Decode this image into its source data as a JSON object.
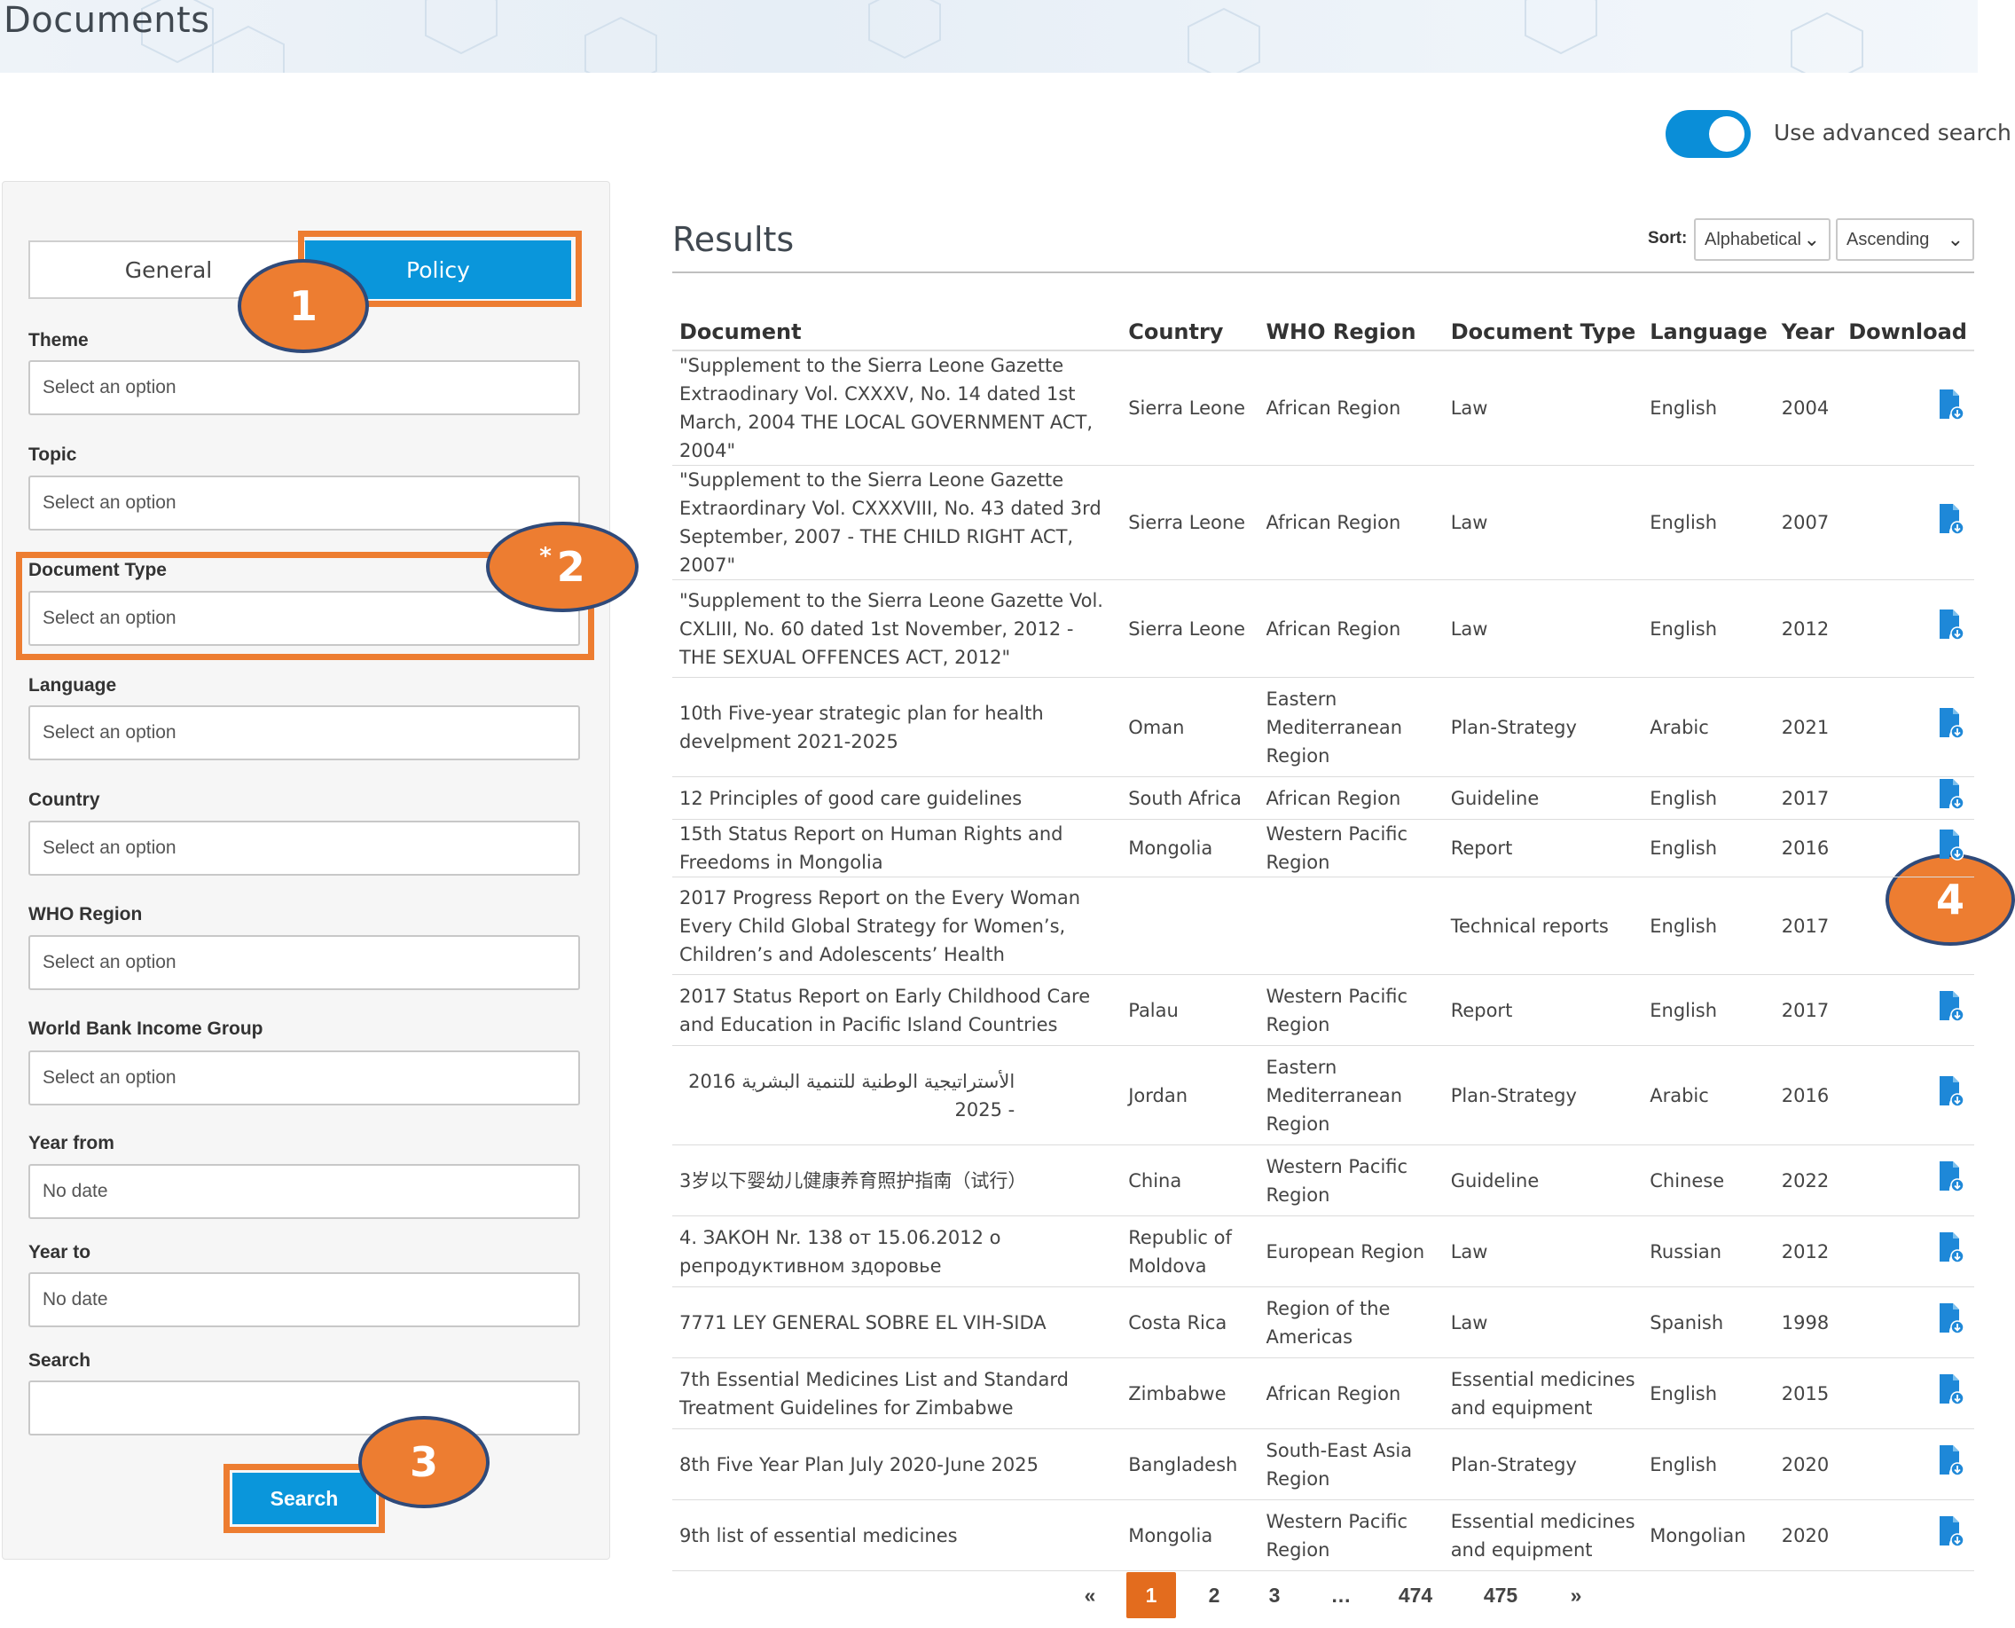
{
  "page": {
    "title": "Documents",
    "advanced_search_label": "Use advanced search",
    "advanced_search_on": true
  },
  "filters": {
    "tabs": {
      "general": "General",
      "policy": "Policy",
      "active": "Policy"
    },
    "theme": {
      "label": "Theme",
      "placeholder": "Select an option"
    },
    "topic": {
      "label": "Topic",
      "placeholder": "Select an option"
    },
    "document_type": {
      "label": "Document Type",
      "placeholder": "Select an option"
    },
    "language": {
      "label": "Language",
      "placeholder": "Select an option"
    },
    "country": {
      "label": "Country",
      "placeholder": "Select an option"
    },
    "who_region": {
      "label": "WHO Region",
      "placeholder": "Select an option"
    },
    "income_group": {
      "label": "World Bank Income Group",
      "placeholder": "Select an option"
    },
    "year_from": {
      "label": "Year from",
      "placeholder": "No date"
    },
    "year_to": {
      "label": "Year to",
      "placeholder": "No date"
    },
    "search": {
      "label": "Search",
      "value": ""
    },
    "search_button": "Search"
  },
  "callouts": [
    "1",
    "2",
    "3",
    "4"
  ],
  "callout_2_mark": "*",
  "results": {
    "title": "Results",
    "sort_label": "Sort:",
    "sort_by": "Alphabetical",
    "sort_order": "Ascending",
    "columns": [
      "Document",
      "Country",
      "WHO Region",
      "Document Type",
      "Language",
      "Year",
      "Download"
    ],
    "rows": [
      {
        "document": "\"Supplement to the Sierra Leone Gazette Extraodinary Vol. CXXXV, No. 14 dated 1st March, 2004 THE LOCAL GOVERNMENT ACT, 2004\"",
        "country": "Sierra Leone",
        "region": "African Region",
        "type": "Law",
        "language": "English",
        "year": "2004",
        "download": true
      },
      {
        "document": "\"Supplement to the Sierra Leone Gazette Extraordinary Vol. CXXXVIII, No. 43 dated 3rd September, 2007 - THE CHILD RIGHT ACT, 2007\"",
        "country": "Sierra Leone",
        "region": "African Region",
        "type": "Law",
        "language": "English",
        "year": "2007",
        "download": true
      },
      {
        "document": "\"Supplement to the Sierra Leone Gazette Vol. CXLIII, No. 60 dated 1st November, 2012 - THE SEXUAL OFFENCES ACT, 2012\"",
        "country": "Sierra Leone",
        "region": "African Region",
        "type": "Law",
        "language": "English",
        "year": "2012",
        "download": true
      },
      {
        "document": "10th Five-year strategic plan for health develpment 2021-2025",
        "country": "Oman",
        "region": "Eastern Mediterranean Region",
        "type": "Plan-Strategy",
        "language": "Arabic",
        "year": "2021",
        "download": true
      },
      {
        "document": "12 Principles of good care guidelines",
        "country": "South Africa",
        "region": "African Region",
        "type": "Guideline",
        "language": "English",
        "year": "2017",
        "download": true
      },
      {
        "document": "15th Status Report on Human Rights and Freedoms in Mongolia",
        "country": "Mongolia",
        "region": "Western Pacific Region",
        "type": "Report",
        "language": "English",
        "year": "2016",
        "download": true
      },
      {
        "document": "2017 Progress Report on the Every Woman Every Child Global Strategy for Women’s, Children’s and Adolescents’ Health",
        "country": "",
        "region": "",
        "type": "Technical reports",
        "language": "English",
        "year": "2017",
        "download": false
      },
      {
        "document": "2017 Status Report on Early Childhood Care and Education in Pacific Island Countries",
        "country": "Palau",
        "region": "Western Pacific Region",
        "type": "Report",
        "language": "English",
        "year": "2017",
        "download": true
      },
      {
        "document": "الأستراتيجية الوطنية للتنمية البشرية 2016 - 2025",
        "country": "Jordan",
        "region": "Eastern Mediterranean Region",
        "type": "Plan-Strategy",
        "language": "Arabic",
        "year": "2016",
        "download": true
      },
      {
        "document": "3岁以下婴幼儿健康养育照护指南（试行）",
        "country": "China",
        "region": "Western Pacific Region",
        "type": "Guideline",
        "language": "Chinese",
        "year": "2022",
        "download": true
      },
      {
        "document": "4. ЗАКОН Nr. 138 от 15.06.2012 о репродуктивном здоровье",
        "country": "Republic of Moldova",
        "region": "European Region",
        "type": "Law",
        "language": "Russian",
        "year": "2012",
        "download": true
      },
      {
        "document": "7771 LEY GENERAL SOBRE EL VIH-SIDA",
        "country": "Costa Rica",
        "region": "Region of the Americas",
        "type": "Law",
        "language": "Spanish",
        "year": "1998",
        "download": true
      },
      {
        "document": "7th Essential Medicines List and Standard Treatment Guidelines for Zimbabwe",
        "country": "Zimbabwe",
        "region": "African Region",
        "type": "Essential medicines and equipment",
        "language": "English",
        "year": "2015",
        "download": true
      },
      {
        "document": "8th Five Year Plan July 2020-June 2025",
        "country": "Bangladesh",
        "region": "South-East Asia Region",
        "type": "Plan-Strategy",
        "language": "English",
        "year": "2020",
        "download": true
      },
      {
        "document": "9th list of essential medicines",
        "country": "Mongolia",
        "region": "Western Pacific Region",
        "type": "Essential medicines and equipment",
        "language": "Mongolian",
        "year": "2020",
        "download": true
      }
    ]
  },
  "pagination": {
    "prev": "«",
    "pages": [
      "1",
      "2",
      "3",
      "…",
      "474",
      "475"
    ],
    "current": "1",
    "next": "»"
  },
  "colors": {
    "accent": "#0a96db",
    "highlight": "#ed7d31",
    "callout_border": "#2f4a7a",
    "active_page": "#e36c1e"
  }
}
